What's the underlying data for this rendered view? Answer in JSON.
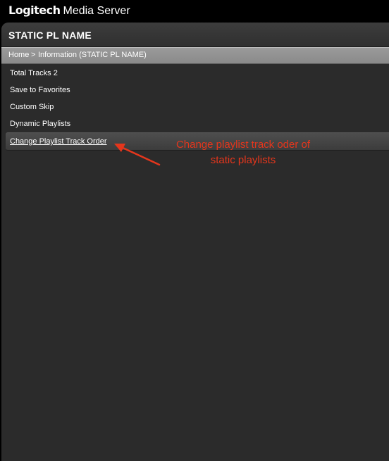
{
  "app": {
    "brand_logo": "Logitech",
    "brand_name": "Media Server"
  },
  "panel": {
    "title": "STATIC PL NAME"
  },
  "breadcrumb": {
    "home": "Home",
    "separator": ">",
    "current": "Information (STATIC PL NAME)"
  },
  "menu": {
    "items": [
      {
        "label": "Total Tracks 2",
        "selected": false
      },
      {
        "label": "Save to Favorites",
        "selected": false
      },
      {
        "label": "Custom Skip",
        "selected": false
      },
      {
        "label": "Dynamic Playlists",
        "selected": false
      },
      {
        "label": "Change Playlist Track Order",
        "selected": true
      }
    ]
  },
  "annotation": {
    "text": "Change playlist track oder of\nstatic playlists",
    "color": "#e5361c"
  },
  "colors": {
    "background": "#000000",
    "panel": "#2b2b2b",
    "breadcrumb": "#8f8f8f",
    "text": "#ffffff"
  }
}
